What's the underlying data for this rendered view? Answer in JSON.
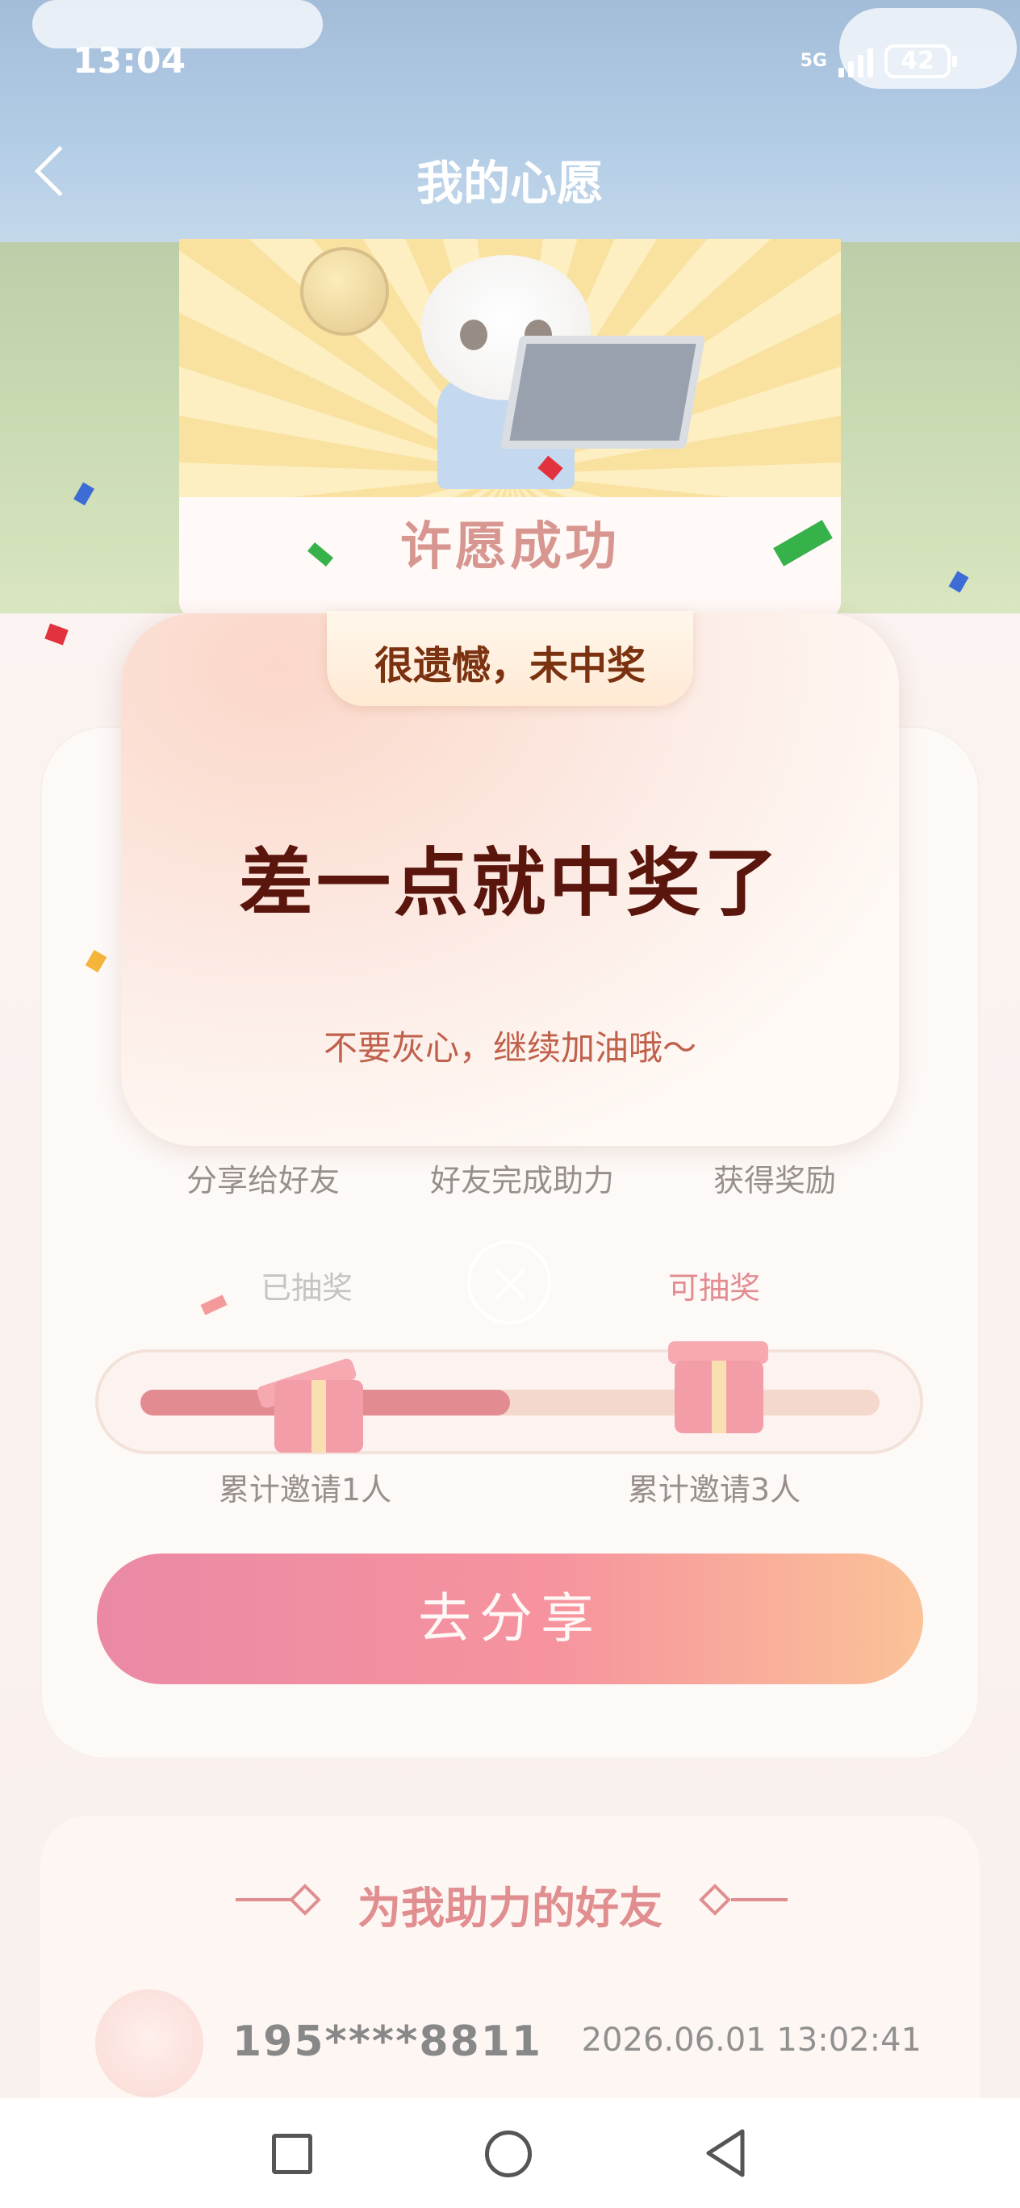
{
  "status_bar": {
    "time": "13:04",
    "network": "5G",
    "battery": "42"
  },
  "header": {
    "title": "我的心愿"
  },
  "banner": {
    "title": "许愿成功"
  },
  "steps": [
    "分享给好友",
    "好友完成助力",
    "获得奖励"
  ],
  "draws": {
    "drawn_label": "已抽奖",
    "available_label": "可抽奖"
  },
  "progress": {
    "fraction": 0.5
  },
  "milestones": [
    "累计邀请1人",
    "累计邀请3人"
  ],
  "share_button": "去分享",
  "friends": {
    "title": "为我助力的好友",
    "items": [
      {
        "phone": "195****8811",
        "time": "2026.06.01 13:02:41"
      }
    ]
  },
  "modal": {
    "tab": "很遗憾，未中奖",
    "heading": "差一点就中奖了",
    "subtitle": "不要灰心，继续加油哦～"
  },
  "colors": {
    "accent": "#c8242f",
    "brand_red": "#b2392b",
    "modal_text": "#5a150d"
  },
  "icons": {
    "back": "chevron-left-icon",
    "close": "close-icon",
    "nav_recent": "square-icon",
    "nav_home": "circle-icon",
    "nav_back": "triangle-back-icon"
  }
}
